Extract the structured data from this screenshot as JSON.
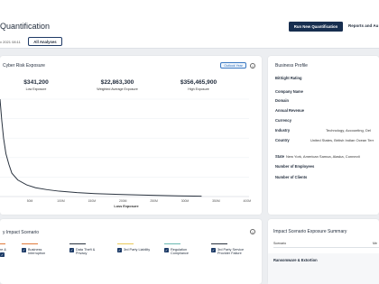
{
  "header": {
    "title": "Quantification",
    "date_text": "v 2021 08:11",
    "all_analyses_label": "All Analyses",
    "run_button_label": "Run New Quantification",
    "reports_label": "Reports and Au"
  },
  "exposure": {
    "title": "Cyber Risk Exposure",
    "badge": "Outlook Year",
    "stats": [
      {
        "value": "$341,200",
        "label": "Low Exposure"
      },
      {
        "value": "$22,863,300",
        "label": "Weighted Average Exposure"
      },
      {
        "value": "$356,465,900",
        "label": "High Exposure"
      }
    ]
  },
  "chart_data": {
    "type": "line",
    "xlabel": "Loss Exposure",
    "x_tick_labels": [
      "50M",
      "100M",
      "150M",
      "200M",
      "250M",
      "300M",
      "350M",
      "400M"
    ],
    "x": [
      0,
      3,
      6,
      10,
      15,
      20,
      30,
      45,
      60,
      80,
      100,
      130,
      160,
      200,
      250,
      300,
      340
    ],
    "y": [
      100,
      78,
      60,
      44,
      33,
      24,
      17,
      12,
      9,
      7,
      5.5,
      4,
      3,
      2.2,
      1.4,
      0.7,
      0.3
    ],
    "ylim": [
      0,
      100
    ],
    "xlim": [
      0,
      420
    ],
    "color": "#2b3440",
    "grid": "horizontal"
  },
  "profile": {
    "title": "Business Profile",
    "fields": [
      {
        "label": "BitSight Rating",
        "value": ""
      },
      {
        "label": "Company Name",
        "value": ""
      },
      {
        "label": "Domain",
        "value": ""
      },
      {
        "label": "Annual Revenue",
        "value": ""
      },
      {
        "label": "Currency",
        "value": ""
      },
      {
        "label": "Industry",
        "value": "Technology, Accounting, Del"
      },
      {
        "label": "Country",
        "value": "United States, British Indian Ocean Terr"
      },
      {
        "label": "State",
        "value": "New York, American Samoa, Alaska, Connecti"
      },
      {
        "label": "Number of Employees",
        "value": ""
      },
      {
        "label": "Number of Clients",
        "value": ""
      }
    ]
  },
  "impact": {
    "title": "y Impact Scenario",
    "scenarios": [
      {
        "line1": "re &",
        "line2": "",
        "color": "#e07a3c"
      },
      {
        "line1": "Business",
        "line2": "Interruption",
        "color": "#e07a3c"
      },
      {
        "line1": "Data Theft &",
        "line2": "Privacy",
        "color": "#2b3440"
      },
      {
        "line1": "3rd Party Liability",
        "line2": "",
        "color": "#e9c95a"
      },
      {
        "line1": "Regulation",
        "line2": "Compliance",
        "color": "#6ab8b0"
      },
      {
        "line1": "3rd Party Service",
        "line2": "Provider Failure",
        "color": "#2b3440"
      }
    ]
  },
  "summary": {
    "title": "Impact Scenario Exposure Summary",
    "col_scenario": "Scenario",
    "col_other": "Me",
    "row_label": "Ransomware & Extortion"
  },
  "icons": {
    "info": "info-icon",
    "checkbox": "checkbox-checked-icon"
  }
}
